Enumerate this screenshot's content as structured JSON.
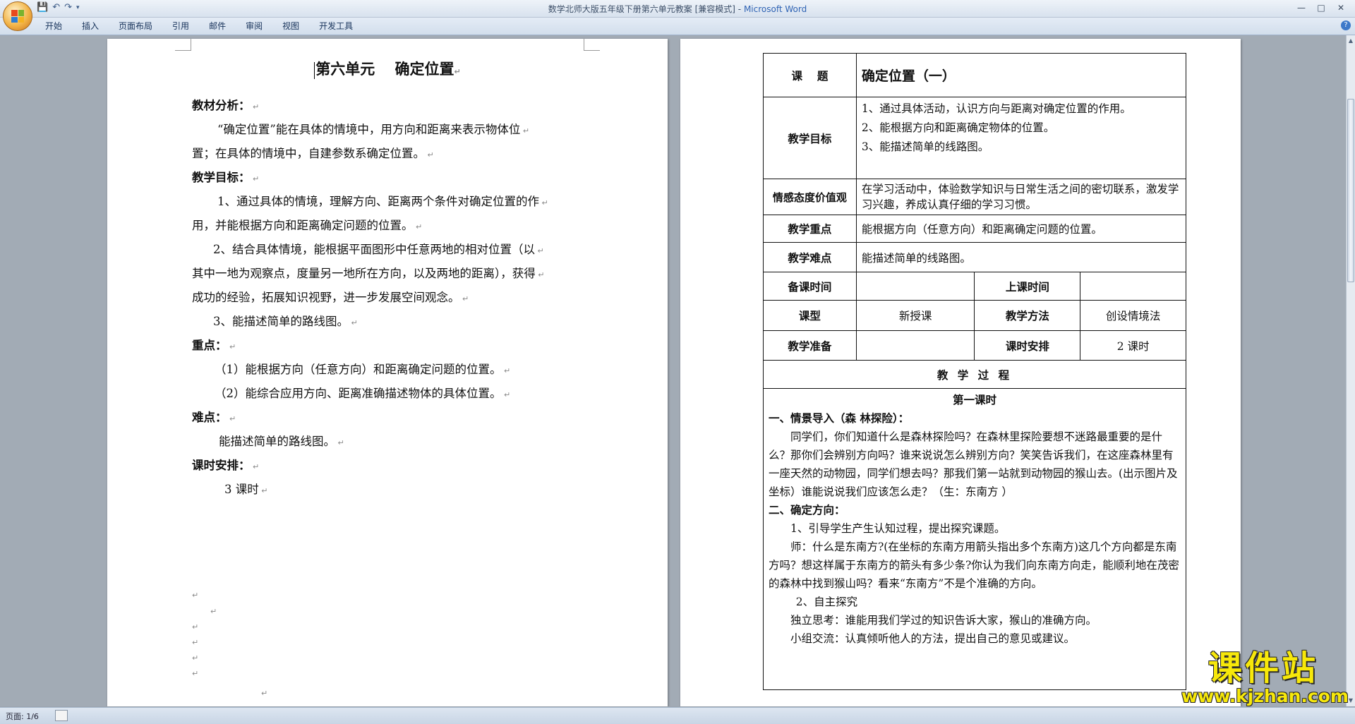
{
  "window": {
    "title": "数学北师大版五年级下册第六单元教案 [兼容模式]",
    "app_name": "Microsoft Word",
    "title_separator": " - "
  },
  "ribbon": {
    "tabs": [
      "开始",
      "插入",
      "页面布局",
      "引用",
      "邮件",
      "审阅",
      "视图",
      "开发工具"
    ]
  },
  "left_page": {
    "title": "第六单元　 确定位置",
    "sections": [
      {
        "text": "教材分析：",
        "bold": true,
        "indent": 0
      },
      {
        "text": "“确定位置”能在具体的情境中，用方向和距离来表示物体位",
        "bold": false,
        "indent": 36
      },
      {
        "text": "置；在具体的情境中，自建参数系确定位置。",
        "bold": false,
        "indent": 0
      },
      {
        "text": "教学目标：",
        "bold": true,
        "indent": 0
      },
      {
        "text": "1、通过具体的情境，理解方向、距离两个条件对确定位置的作",
        "bold": false,
        "indent": 36
      },
      {
        "text": "用，并能根据方向和距离确定问题的位置。",
        "bold": false,
        "indent": 0
      },
      {
        "text": "2、结合具体情境，能根据平面图形中任意两地的相对位置（以",
        "bold": false,
        "indent": 30
      },
      {
        "text": "其中一地为观察点，度量另一地所在方向，以及两地的距离），获得",
        "bold": false,
        "indent": 0
      },
      {
        "text": "成功的经验，拓展知识视野，进一步发展空间观念。",
        "bold": false,
        "indent": 0
      },
      {
        "text": "3、能描述简单的路线图。",
        "bold": false,
        "indent": 30
      },
      {
        "text": "重点：",
        "bold": true,
        "indent": 0
      },
      {
        "text": "（1）能根据方向（任意方向）和距离确定问题的位置。",
        "bold": false,
        "indent": 32
      },
      {
        "text": "（2）能综合应用方向、距离准确描述物体的具体位置。",
        "bold": false,
        "indent": 32
      },
      {
        "text": "难点：",
        "bold": true,
        "indent": 0
      },
      {
        "text": "能描述简单的路线图。",
        "bold": false,
        "indent": 38
      },
      {
        "text": "课时安排：",
        "bold": true,
        "indent": 0
      },
      {
        "text": "3 课时",
        "bold": false,
        "indent": 46
      }
    ]
  },
  "right_page": {
    "table": {
      "topic_label": "课　 题",
      "topic_value": "确定位置（一）",
      "goals_label": "教学目标",
      "goals": [
        "1、通过具体活动，认识方向与距离对确定位置的作用。",
        "2、能根据方向和距离确定物体的位置。",
        "3、能描述简单的线路图。"
      ],
      "attitude_label": "情感态度价值观",
      "attitude_value": "在学习活动中，体验数学知识与日常生活之间的密切联系，激发学习兴趣，养成认真仔细的学习习惯。",
      "key_label": "教学重点",
      "key_value": "能根据方向（任意方向）和距离确定问题的位置。",
      "difficulty_label": "教学难点",
      "difficulty_value": "能描述简单的线路图。",
      "prep_time_label": "备课时间",
      "prep_time_value": "",
      "class_time_label": "上课时间",
      "class_time_value": "",
      "type_label": "课型",
      "type_value": "新授课",
      "method_label": "教学方法",
      "method_value": "创设情境法",
      "materials_label": "教学准备",
      "materials_value": "",
      "hours_label": "课时安排",
      "hours_value": "2 课时",
      "process_header": "教 学 过 程",
      "lesson_title": "第一课时",
      "process": [
        {
          "text": "一、情景导入（森 林探险）：",
          "bold_prefix": "一、情景导入",
          "indent": 0
        },
        {
          "text": "同学们，你们知道什么是森林探险吗？在森林里探险要想不迷路最重要的是什么？那你们会辨别方向吗？谁来说说怎么辨别方向？笑笑告诉我们，在这座森林里有一座天然的动物园，同学们想去吗？那我们第一站就到动物园的猴山去。(出示图片及坐标）谁能说说我们应该怎么走？（生：东南方 ）",
          "bold_prefix": "",
          "indent": 2
        },
        {
          "text": "二、确定方向：",
          "bold_prefix": "二、确定方向：",
          "indent": 0
        },
        {
          "text": "1、引导学生产生认知过程，提出探究课题。",
          "bold_prefix": "",
          "indent": 2
        },
        {
          "text": "师：什么是东南方?(在坐标的东南方用箭头指出多个东南方)这几个方向都是东南方吗？想这样属于东南方的箭头有多少条?你认为我们向东南方向走，能顺利地在茂密的森林中找到猴山吗？看来“东南方”不是个准确的方向。",
          "bold_prefix": "",
          "indent": 2
        },
        {
          "text": "2、自主探究",
          "bold_prefix": "",
          "indent": 2.5
        },
        {
          "text": "独立思考：谁能用我们学过的知识告诉大家，猴山的准确方向。",
          "bold_prefix": "",
          "indent": 2
        },
        {
          "text": "小组交流：认真倾听他人的方法，提出自己的意见或建议。",
          "bold_prefix": "",
          "indent": 2
        }
      ]
    }
  },
  "status": {
    "page_info": "页面: 1/6"
  },
  "watermark": {
    "line1": "课件站",
    "line2": "www.kjzhan.com"
  },
  "colors": {
    "title_app": "#2f63b4",
    "workspace": "#a2abb5",
    "watermark": "#f7e80a"
  }
}
